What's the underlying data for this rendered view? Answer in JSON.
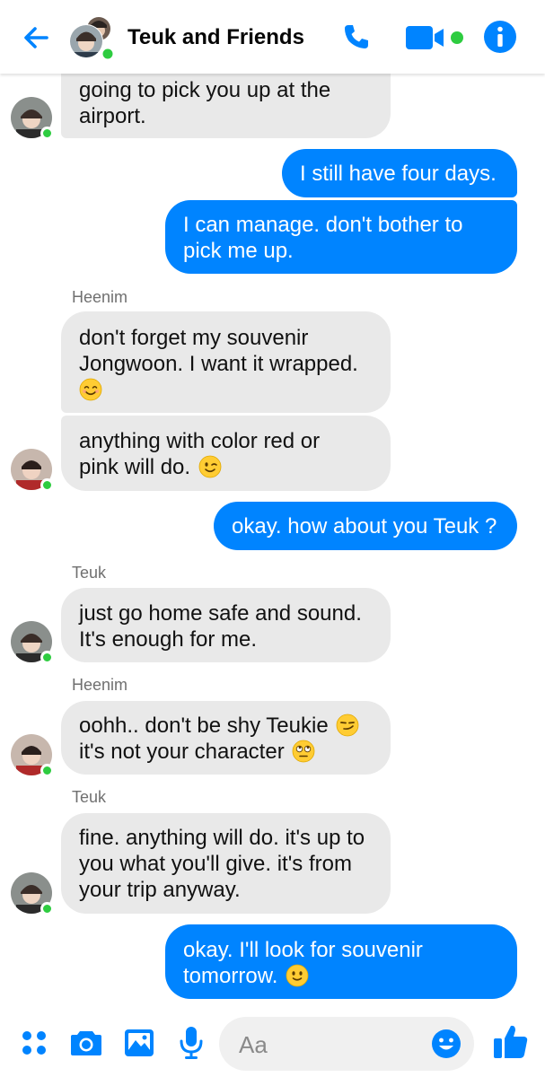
{
  "header": {
    "title": "Teuk and Friends",
    "back_icon": "arrow-left-icon",
    "call_icon": "phone-icon",
    "video_icon": "video-camera-icon",
    "info_icon": "info-icon",
    "accent": "#0084ff",
    "online_color": "#2ecc40"
  },
  "messages": [
    {
      "side": "in",
      "sender": "",
      "lines": [
        "going to pick you up at the",
        "airport."
      ]
    },
    {
      "side": "out",
      "lines": [
        "I still have four days."
      ]
    },
    {
      "side": "out",
      "lines": [
        "I can manage. don't bother to",
        "pick me up."
      ]
    },
    {
      "side": "in",
      "sender": "Heenim",
      "lines": [
        "don't forget my souvenir",
        "Jongwoon. I want it wrapped."
      ],
      "emoji": "smiling-face-icon"
    },
    {
      "side": "in",
      "sender": "",
      "lines": [
        "anything with color red or",
        "pink will do."
      ],
      "emoji": "winking-face-icon"
    },
    {
      "side": "out",
      "lines": [
        "okay. how about you Teuk ?"
      ]
    },
    {
      "side": "in",
      "sender": "Teuk",
      "lines": [
        "just go home safe and sound.",
        "It's enough for me."
      ]
    },
    {
      "side": "in",
      "sender": "Heenim",
      "lines": [
        "oohh.. don't be shy Teukie",
        "it's not your character"
      ],
      "emoji": [
        "smirking-face-icon",
        "eye-roll-face-icon"
      ]
    },
    {
      "side": "in",
      "sender": "Teuk",
      "lines": [
        "fine. anything will do. it's up to",
        "you what you'll give. it's from",
        "your trip anyway."
      ]
    },
    {
      "side": "out",
      "lines": [
        "okay. I'll look for souvenir",
        "tomorrow."
      ],
      "emoji": "slight-smile-face-icon"
    }
  ],
  "composer": {
    "placeholder": "Aa",
    "icons": [
      "menu-dots-icon",
      "camera-icon",
      "image-icon",
      "microphone-icon",
      "emoji-icon",
      "thumbs-up-icon"
    ]
  },
  "colors": {
    "incoming_bubble": "#e9e9e9",
    "outgoing_bubble": "#0084ff"
  }
}
